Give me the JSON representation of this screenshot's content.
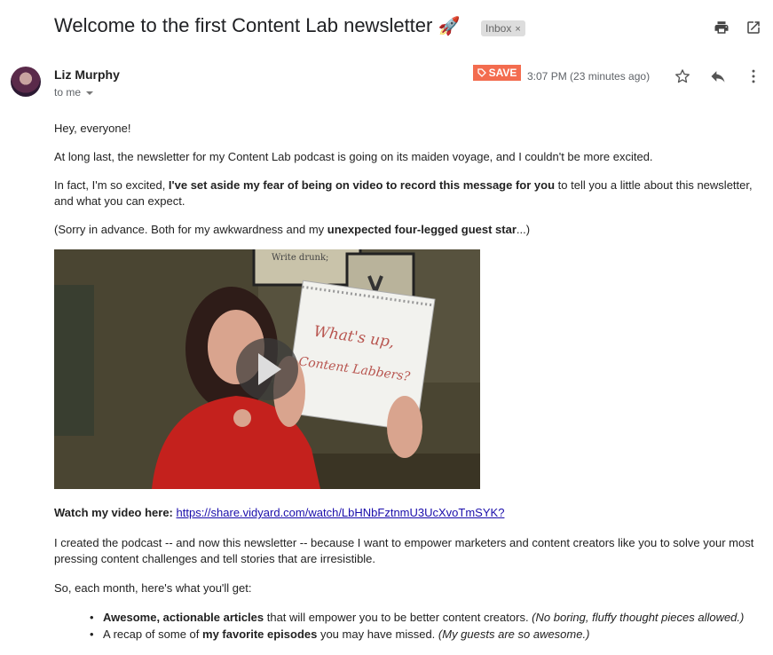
{
  "email": {
    "subject": "Welcome to the first Content Lab newsletter",
    "subject_emoji": "🚀",
    "label_chip": "Inbox",
    "label_close": "×",
    "sender_name": "Liz Murphy",
    "recipient": "to me",
    "save_label": "SAVE",
    "timestamp": "3:07 PM (23 minutes ago)"
  },
  "body": {
    "greeting": "Hey, everyone!",
    "p1": "At long last, the newsletter for my Content Lab podcast is going on its maiden voyage, and I couldn't be more excited.",
    "p2_a": "In fact, I'm so excited, ",
    "p2_b": "I've set aside my fear of being on video to record this message for you",
    "p2_c": " to tell you a little about this newsletter, and what you can expect.",
    "p3_a": "(Sorry in advance. Both for my awkwardness and my ",
    "p3_b": "unexpected four-legged guest star",
    "p3_c": "...)",
    "video_sign_text_1": "What's up,",
    "video_sign_text_2": "Content Labbers?",
    "video_poster_text": "Write drunk;",
    "watch_label": "Watch my video here:",
    "watch_link": "https://share.vidyard.com/watch/LbHNbFztnmU3UcXvoTmSYK?",
    "p4": "I created the podcast -- and now this newsletter -- because I want to empower marketers and content creators like you to solve your most pressing content challenges and tell stories that are irresistible.",
    "p5": "So, each month, here's what you'll get:",
    "bullet1_a": "Awesome, actionable articles",
    "bullet1_b": " that will empower you to be better content creators. ",
    "bullet1_c": "(No boring, fluffy thought pieces allowed.)",
    "bullet2_a": "A recap of some of ",
    "bullet2_b": "my favorite episodes",
    "bullet2_c": " you may have missed. ",
    "bullet2_d": "(My guests are so awesome.)"
  },
  "icons": {
    "print": "print-icon",
    "popout": "open-in-new-window-icon",
    "star": "star-icon",
    "reply": "reply-icon",
    "more": "more-vertical-icon",
    "play": "play-icon"
  },
  "colors": {
    "save_button": "#f36c4f",
    "link": "#1a0dab"
  }
}
